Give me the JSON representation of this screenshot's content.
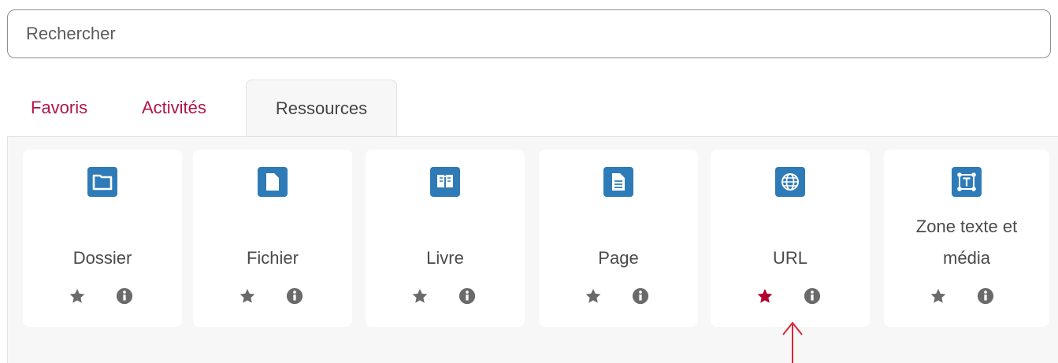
{
  "search": {
    "placeholder": "Rechercher"
  },
  "tabs": [
    {
      "label": "Favoris"
    },
    {
      "label": "Activités"
    },
    {
      "label": "Ressources"
    }
  ],
  "colors": {
    "accent": "#b0144a",
    "icon_bg": "#2e7bb8",
    "star_default": "#6a6a6a",
    "star_favorite": "#b0002e"
  },
  "cards": [
    {
      "name": "Dossier",
      "icon": "folder-icon",
      "favorite": false
    },
    {
      "name": "Fichier",
      "icon": "file-icon",
      "favorite": false
    },
    {
      "name": "Livre",
      "icon": "book-icon",
      "favorite": false
    },
    {
      "name": "Page",
      "icon": "page-icon",
      "favorite": false
    },
    {
      "name": "URL",
      "icon": "globe-icon",
      "favorite": true
    },
    {
      "name": "Zone texte et média",
      "name_line1": "Zone texte et",
      "name_line2": "média",
      "icon": "text-area-icon",
      "favorite": false
    }
  ]
}
